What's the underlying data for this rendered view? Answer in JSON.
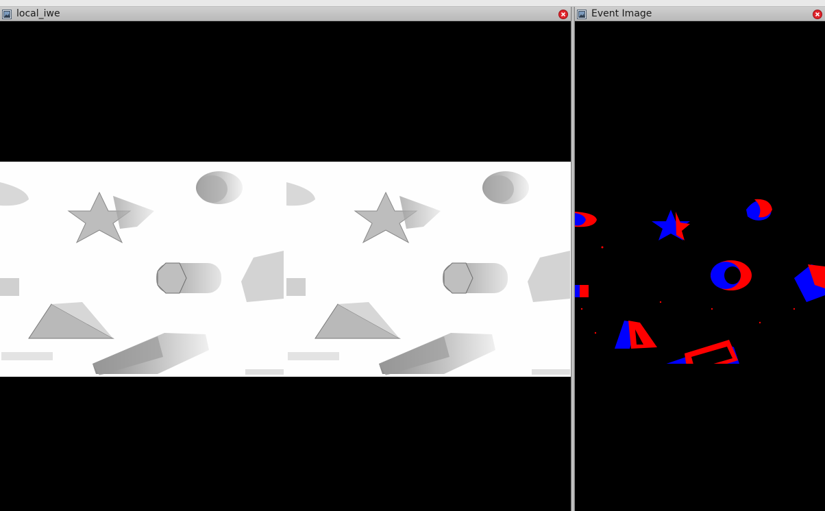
{
  "windows": {
    "local_iwe": {
      "title": "local_iwe"
    },
    "event_image": {
      "title": "Event Image"
    }
  },
  "icons": {
    "window_icon": "window-icon",
    "close_icon": "close-icon"
  },
  "colors": {
    "titlebar": "#c4c4c4",
    "close": "#e0242b",
    "event_positive": "#ff0000",
    "event_negative": "#0000ff",
    "background": "#000000"
  }
}
